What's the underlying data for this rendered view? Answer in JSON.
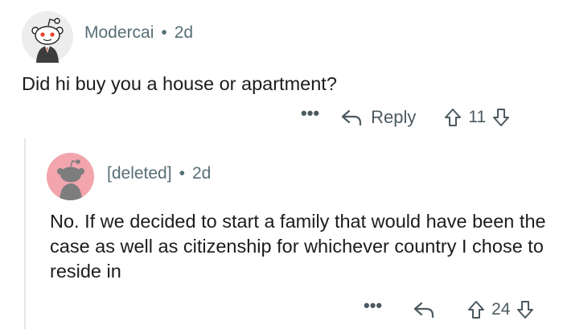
{
  "comment1": {
    "author": "Modercai",
    "time": "2d",
    "body": "Did hi buy you a house or apartment?",
    "more_label": "•••",
    "reply_label": "Reply",
    "score": "11"
  },
  "comment2": {
    "author": "[deleted]",
    "time": "2d",
    "body": "No. If we decided to start a family that would have been the case as well as citizenship for whichever country I chose to reside in",
    "more_label": "•••",
    "score": "24"
  },
  "separator": "•",
  "icons": {
    "comment1_avatar": "snoo-avatar-icon",
    "comment2_avatar": "deleted-user-avatar-icon",
    "reply": "reply-arrow-icon",
    "upvote": "upvote-arrow-icon",
    "downvote": "downvote-arrow-icon"
  },
  "colors": {
    "meta_text": "#576f76",
    "action_text": "#4b5a60",
    "deleted_avatar_bg": "#f2a5ad",
    "snoo_avatar_bg": "#ededed",
    "thread_line": "#e4e6e8"
  }
}
